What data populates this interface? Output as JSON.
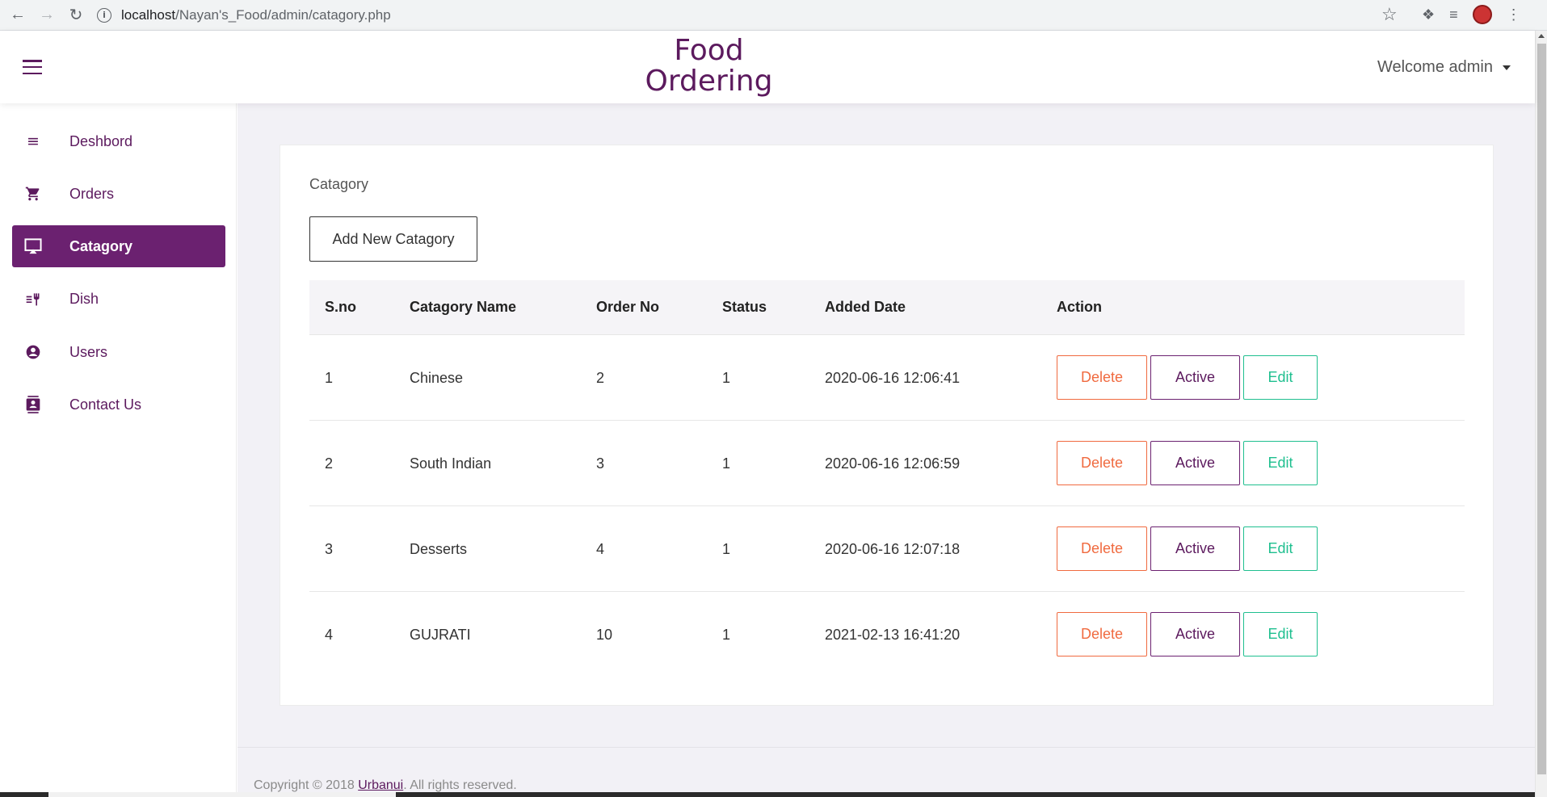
{
  "browser": {
    "url_host": "localhost",
    "url_path": "/Nayan's_Food/admin/catagory.php"
  },
  "header": {
    "brand_line1": "Food",
    "brand_line2": "Ordering",
    "welcome": "Welcome admin"
  },
  "sidebar": {
    "items": [
      {
        "label": "Deshbord",
        "icon": "menu-lines-icon"
      },
      {
        "label": "Orders",
        "icon": "cart-icon"
      },
      {
        "label": "Catagory",
        "icon": "monitor-icon",
        "active": true
      },
      {
        "label": "Dish",
        "icon": "dish-icon"
      },
      {
        "label": "Users",
        "icon": "user-circle-icon"
      },
      {
        "label": "Contact Us",
        "icon": "contact-card-icon"
      }
    ]
  },
  "main": {
    "card_title": "Catagory",
    "add_button": "Add New Catagory",
    "table": {
      "headers": [
        "S.no",
        "Catagory Name",
        "Order No",
        "Status",
        "Added Date",
        "Action"
      ],
      "rows": [
        {
          "sno": "1",
          "name": "Chinese",
          "order": "2",
          "status": "1",
          "date": "2020-06-16 12:06:41"
        },
        {
          "sno": "2",
          "name": "South Indian",
          "order": "3",
          "status": "1",
          "date": "2020-06-16 12:06:59"
        },
        {
          "sno": "3",
          "name": "Desserts",
          "order": "4",
          "status": "1",
          "date": "2020-06-16 12:07:18"
        },
        {
          "sno": "4",
          "name": "GUJRATI",
          "order": "10",
          "status": "1",
          "date": "2021-02-13 16:41:20"
        }
      ],
      "actions": {
        "delete": "Delete",
        "active": "Active",
        "edit": "Edit"
      }
    }
  },
  "footer": {
    "prefix": "Copyright © 2018 ",
    "link": "Urbanui",
    "suffix": ". All rights reserved."
  },
  "colors": {
    "brand": "#5c1a5e",
    "active_bg": "#6b2170",
    "delete": "#f06a3f",
    "edit": "#1fbf8f"
  }
}
